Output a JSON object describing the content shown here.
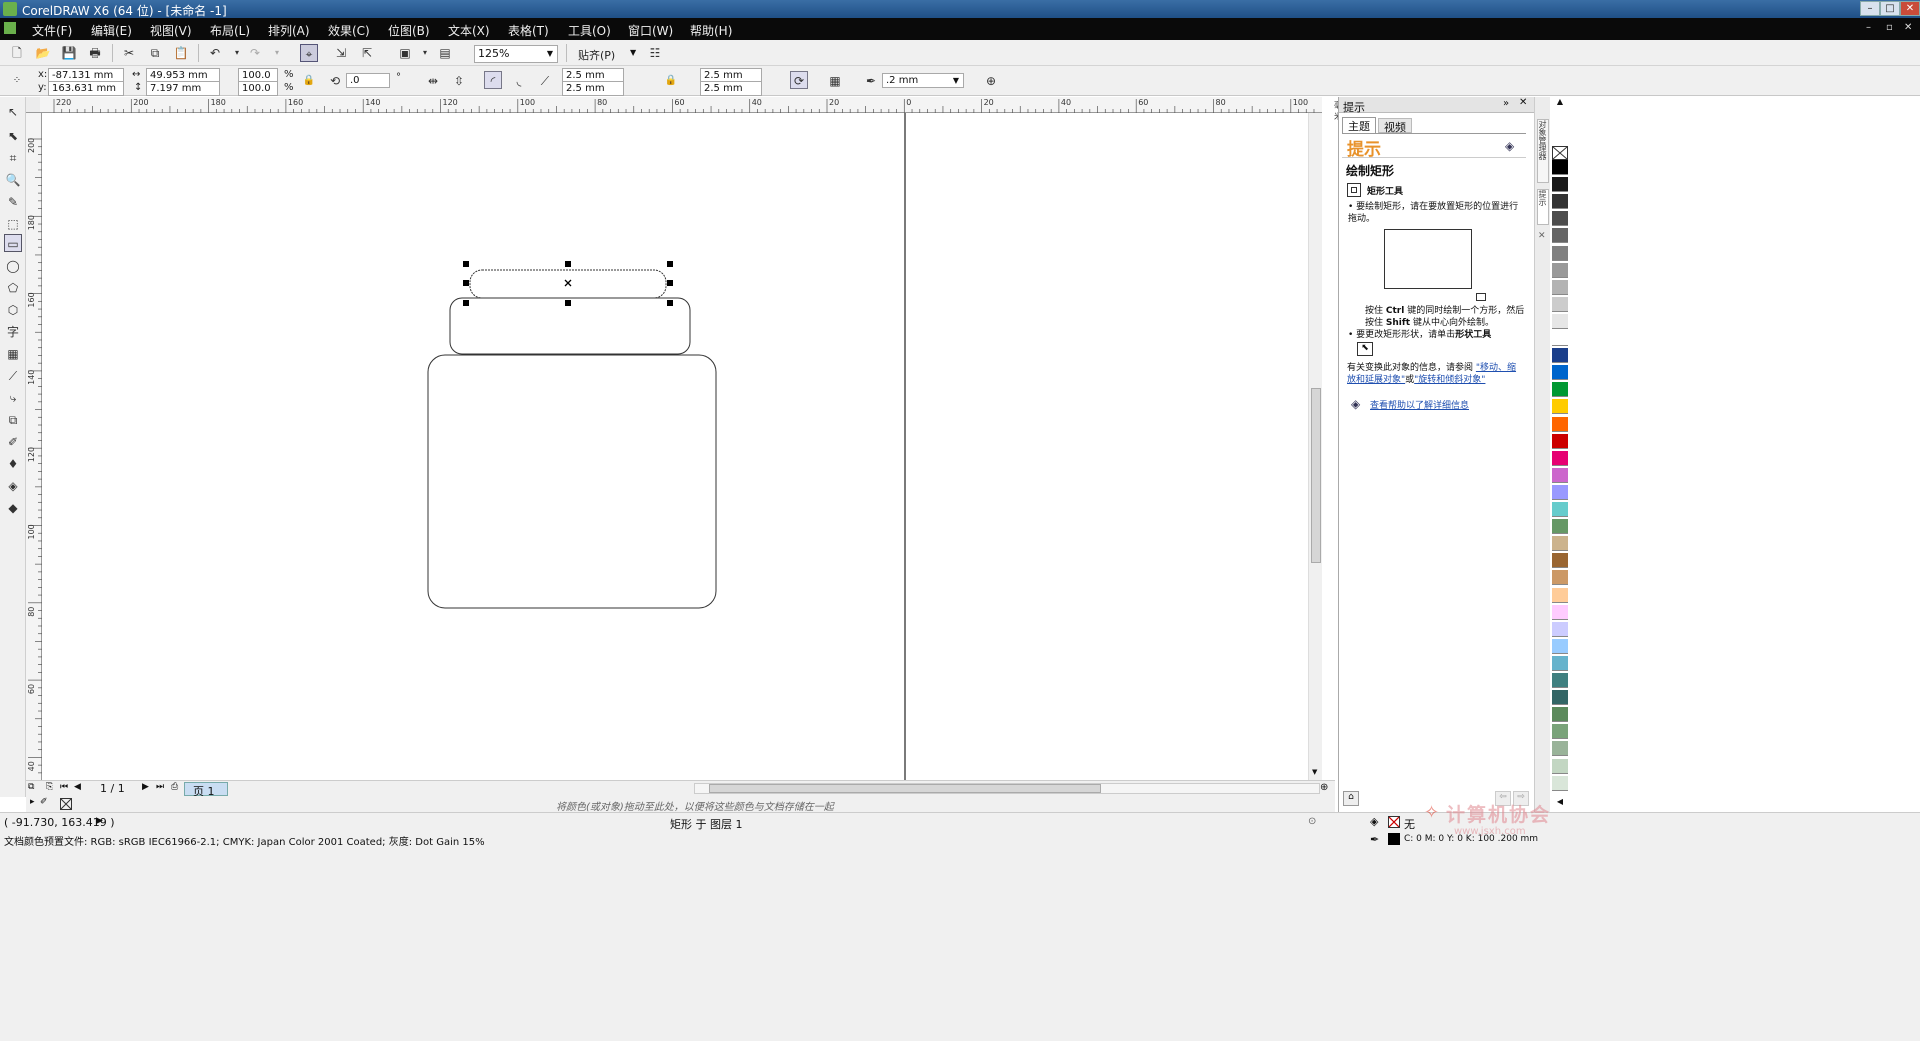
{
  "window": {
    "title": "CorelDRAW X6 (64 位) - [未命名 -1]"
  },
  "menu": [
    "文件(F)",
    "编辑(E)",
    "视图(V)",
    "布局(L)",
    "排列(A)",
    "效果(C)",
    "位图(B)",
    "文本(X)",
    "表格(T)",
    "工具(O)",
    "窗口(W)",
    "帮助(H)"
  ],
  "toolbar": {
    "zoom": "125%",
    "snap_label": "贴齐(P)"
  },
  "property_bar": {
    "x": "-87.131 mm",
    "y": "163.631 mm",
    "w": "49.953 mm",
    "h": "7.197 mm",
    "scale_w": "100.0",
    "scale_h": "100.0",
    "pct": "%",
    "rotation": ".0",
    "deg": "°",
    "corner_tl": "2.5 mm",
    "corner_bl": "2.5 mm",
    "corner_tr": "2.5 mm",
    "corner_br": "2.5 mm",
    "outline": ".2 mm"
  },
  "rulers": {
    "h_labels": [
      "220",
      "200",
      "180",
      "160",
      "140",
      "120",
      "100",
      "80",
      "60",
      "40",
      "20",
      "0",
      "20",
      "40",
      "60",
      "80",
      "100"
    ],
    "h_unit": "毫米",
    "v_labels": [
      "200",
      "180",
      "160",
      "140",
      "120",
      "100",
      "80",
      "60",
      "40"
    ]
  },
  "pages": {
    "counter": "1 / 1",
    "tab": "页 1"
  },
  "palette_hint": "将颜色(或对象)拖动至此处，以便将这些颜色与文档存储在一起",
  "status": {
    "coords": "( -91.730, 163.419 )",
    "object_info": "矩形 于 图层 1",
    "profile": "文档颜色预置文件: RGB: sRGB IEC61966-2.1; CMYK: Japan Color 2001 Coated; 灰度: Dot Gain 15%",
    "fill_none": "无",
    "outline_info": "C: 0 M: 0 Y: 0 K: 100 .200 mm"
  },
  "docker": {
    "header": "提示",
    "tabs": [
      "主题",
      "视频"
    ],
    "big_title": "提示",
    "section": "绘制矩形",
    "tool_name": "矩形工具",
    "bullet1": "要绘制矩形，请在要放置矩形的位置进行拖动。",
    "note1_a": "按住",
    "note1_ctrl": "Ctrl",
    "note1_b": "键的同时绘制一个方形，然后",
    "note2_a": "按住",
    "note2_shift": "Shift",
    "note2_b": "键从中心向外绘制。",
    "bullet2_a": "要更改矩形形状，请单击",
    "bullet2_b": "形状工具",
    "more_a": "有关变换此对象的信息，请参阅",
    "link1": "\"移动、缩放和延展对象\"",
    "more_or": "或",
    "link2": "\"旋转和倾斜对象\"",
    "link3": "查看帮助以了解详细信息",
    "side_tab1": "对象管理器",
    "side_tab2": "提示"
  },
  "watermark": {
    "title": "计算机协会",
    "url": "www.jsxh.com"
  },
  "colors": {
    "accent": "#e8922a",
    "link": "#1f4fb0",
    "palette": [
      "#000000",
      "#1a1a1a",
      "#333333",
      "#4d4d4d",
      "#666666",
      "#808080",
      "#999999",
      "#b3b3b3",
      "#cccccc",
      "#e6e6e6",
      "#ffffff",
      "#1b3f8b",
      "#0066cc",
      "#009933",
      "#ffcc00",
      "#ff6600",
      "#cc0000",
      "#e60073",
      "#cc66cc",
      "#9999ff",
      "#66cccc",
      "#669966",
      "#ccb38c",
      "#996633",
      "#cc9966",
      "#ffcc99",
      "#ffccff",
      "#ccccff",
      "#99ccff",
      "#66b3cc",
      "#408080",
      "#336666",
      "#5c8a5c",
      "#7aa37a",
      "#99b399",
      "#c2d6c2",
      "#d9e6d9"
    ]
  }
}
